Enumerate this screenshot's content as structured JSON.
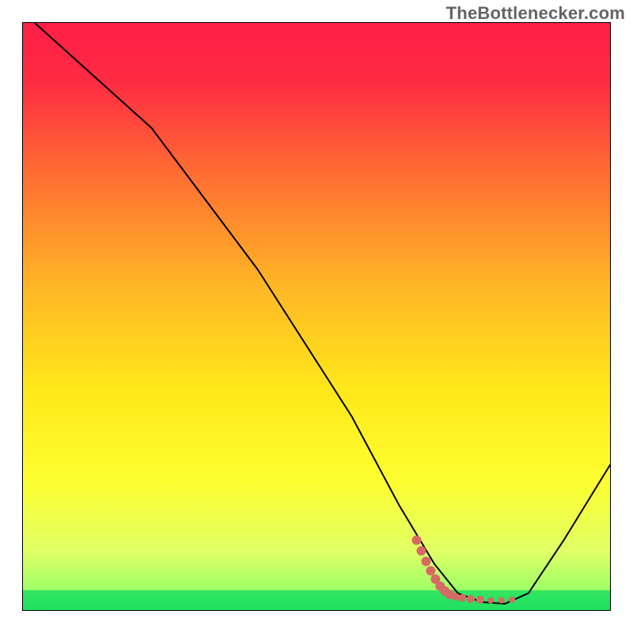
{
  "watermark": "TheBottlenecker.com",
  "chart_data": {
    "type": "line",
    "title": "",
    "xlabel": "",
    "ylabel": "",
    "xlim": [
      0,
      100
    ],
    "ylim": [
      0,
      100
    ],
    "grid": false,
    "gradient_stops": [
      {
        "offset": 0.0,
        "color": "#ff1f47"
      },
      {
        "offset": 0.1,
        "color": "#ff2b42"
      },
      {
        "offset": 0.25,
        "color": "#ff6a33"
      },
      {
        "offset": 0.45,
        "color": "#ffb725"
      },
      {
        "offset": 0.62,
        "color": "#ffe71a"
      },
      {
        "offset": 0.78,
        "color": "#fdff30"
      },
      {
        "offset": 0.9,
        "color": "#e0ff66"
      },
      {
        "offset": 0.965,
        "color": "#9cff66"
      },
      {
        "offset": 0.985,
        "color": "#35e85a"
      },
      {
        "offset": 1.0,
        "color": "#1de060"
      }
    ],
    "green_band": {
      "y_center": 2,
      "height": 3
    },
    "series": [
      {
        "name": "curve",
        "stroke": "#000000",
        "stroke_width": 2,
        "points": [
          {
            "x": 2,
            "y": 100
          },
          {
            "x": 22,
            "y": 82
          },
          {
            "x": 40,
            "y": 58
          },
          {
            "x": 56,
            "y": 33
          },
          {
            "x": 64,
            "y": 18
          },
          {
            "x": 70,
            "y": 8
          },
          {
            "x": 74,
            "y": 3
          },
          {
            "x": 78,
            "y": 1.5
          },
          {
            "x": 82,
            "y": 1.2
          },
          {
            "x": 86,
            "y": 3
          },
          {
            "x": 92,
            "y": 12
          },
          {
            "x": 100,
            "y": 25
          }
        ]
      }
    ],
    "markers": {
      "color": "#d76a65",
      "points": [
        {
          "x": 67.0,
          "y": 12.0,
          "r": 6
        },
        {
          "x": 67.8,
          "y": 10.2,
          "r": 6
        },
        {
          "x": 68.6,
          "y": 8.4,
          "r": 6
        },
        {
          "x": 69.4,
          "y": 6.8,
          "r": 6
        },
        {
          "x": 70.2,
          "y": 5.4,
          "r": 6
        },
        {
          "x": 71.0,
          "y": 4.2,
          "r": 6
        },
        {
          "x": 71.8,
          "y": 3.4,
          "r": 6
        },
        {
          "x": 72.6,
          "y": 2.8,
          "r": 6
        },
        {
          "x": 73.6,
          "y": 2.4,
          "r": 5
        },
        {
          "x": 74.8,
          "y": 2.2,
          "r": 5
        },
        {
          "x": 76.2,
          "y": 2.0,
          "r": 5
        },
        {
          "x": 77.8,
          "y": 1.9,
          "r": 5
        },
        {
          "x": 79.6,
          "y": 1.8,
          "r": 4
        },
        {
          "x": 81.4,
          "y": 1.8,
          "r": 4
        },
        {
          "x": 83.2,
          "y": 1.9,
          "r": 4
        }
      ]
    }
  }
}
